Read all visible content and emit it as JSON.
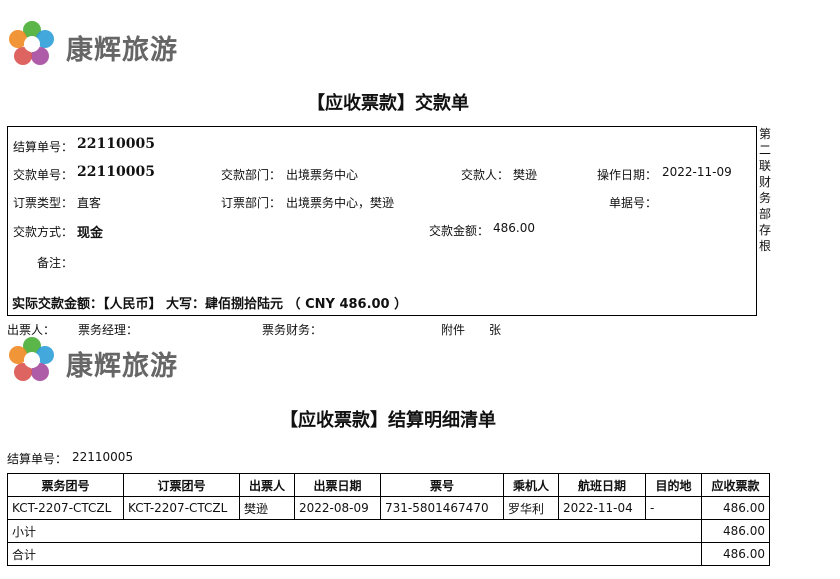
{
  "brand": {
    "name": "康辉旅游"
  },
  "receipt": {
    "title": "【应收票款】交款单",
    "settle_no_label": "结算单号：",
    "settle_no": "22110005",
    "pay_no_label": "交款单号：",
    "pay_no": "22110005",
    "pay_dept_label": "交款部门：",
    "pay_dept": "出境票务中心",
    "payer_label": "交款人：",
    "payer": "樊逊",
    "op_date_label": "操作日期：",
    "op_date": "2022-11-09",
    "ticket_type_label": "订票类型：",
    "ticket_type": "直客",
    "order_dept_label": "订票部门：",
    "order_dept": "出境票务中心，樊逊",
    "doc_no_label": "单据号：",
    "doc_no": "",
    "pay_method_label": "交款方式：",
    "pay_method": "现金",
    "pay_amount_label": "交款金额：",
    "pay_amount": "486.00",
    "remark_label": "备注：",
    "remark": "",
    "actual_line": "实际交款金额：【人民币】 大写：肆佰捌拾陆元 （ CNY 486.00 ）",
    "side_note": [
      "第",
      "二",
      "联",
      "财",
      "务",
      "部",
      "存",
      "根"
    ],
    "footer": {
      "issuer_label": "出票人：",
      "manager_label": "票务经理：",
      "finance_label": "票务财务：",
      "attach_label": "附件",
      "unit_label": "张"
    }
  },
  "detail": {
    "title": "【应收票款】结算明细清单",
    "settle_no_label": "结算单号：",
    "settle_no": "22110005",
    "columns": [
      "票务团号",
      "订票团号",
      "出票人",
      "出票日期",
      "票号",
      "乘机人",
      "航班日期",
      "目的地",
      "应收票款"
    ],
    "rows": [
      [
        "KCT-2207-CTCZL",
        "KCT-2207-CTCZL",
        "樊逊",
        "2022-08-09",
        "731-5801467470",
        "罗华利",
        "2022-11-04",
        "-",
        "486.00"
      ]
    ],
    "subtotal_label": "小计",
    "subtotal": "486.00",
    "total_label": "合计",
    "total": "486.00"
  },
  "colors": {
    "logo_green": "#5bb64a",
    "logo_blue": "#2f9fd8",
    "logo_orange": "#f08a24",
    "logo_purple": "#a54a9e"
  }
}
